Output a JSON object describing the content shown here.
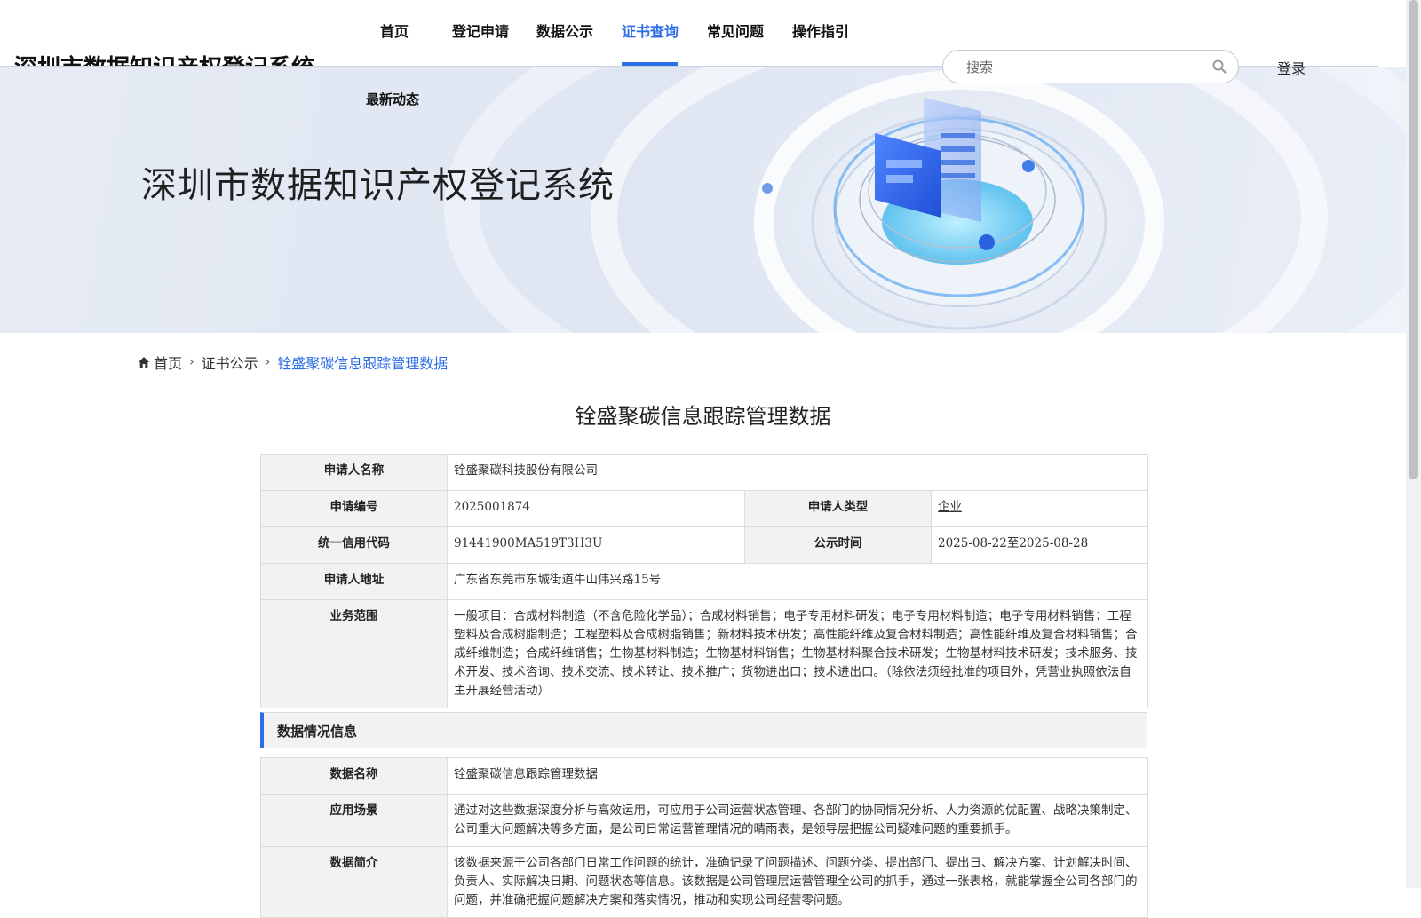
{
  "header": {
    "site_title": "深圳市数据知识产权登记系统",
    "nav": [
      {
        "label": "首页"
      },
      {
        "label": "登记申请"
      },
      {
        "label": "数据公示"
      },
      {
        "label": "证书查询",
        "active": true
      },
      {
        "label": "常见问题"
      },
      {
        "label": "操作指引"
      },
      {
        "label": "最新动态"
      }
    ],
    "search_placeholder": "搜索",
    "login_label": "登录"
  },
  "banner": {
    "title": "深圳市数据知识产权登记系统"
  },
  "breadcrumb": [
    "首页",
    "证书公示",
    "铨盛聚碳信息跟踪管理数据"
  ],
  "page_title": "铨盛聚碳信息跟踪管理数据",
  "applicant": {
    "name_label": "申请人名称",
    "name_value": "铨盛聚碳科技股份有限公司",
    "number_label": "申请编号",
    "number_value": "2025001874",
    "type_label": "申请人类型",
    "type_value": "企业",
    "credit_label": "统一信用代码",
    "credit_value": "91441900MA519T3H3U",
    "publicity_label": "公示时间",
    "publicity_value": "2025-08-22至2025-08-28",
    "address_label": "申请人地址",
    "address_value": "广东省东莞市东城街道牛山伟兴路15号",
    "scope_label": "业务范围",
    "scope_value": "一般项目：合成材料制造（不含危险化学品）；合成材料销售；电子专用材料研发；电子专用材料制造；电子专用材料销售；工程塑料及合成树脂制造；工程塑料及合成树脂销售；新材料技术研发；高性能纤维及复合材料制造；高性能纤维及复合材料销售；合成纤维制造；合成纤维销售；生物基材料制造；生物基材料销售；生物基材料聚合技术研发；生物基材料技术研发；技术服务、技术开发、技术咨询、技术交流、技术转让、技术推广；货物进出口；技术进出口。（除依法须经批准的项目外，凭营业执照依法自主开展经营活动）"
  },
  "data_section": {
    "title": "数据情况信息",
    "data_name_label": "数据名称",
    "data_name_value": "铨盛聚碳信息跟踪管理数据",
    "scenario_label": "应用场景",
    "scenario_value": "通过对这些数据深度分析与高效运用，可应用于公司运营状态管理、各部门的协同情况分析、人力资源的优配置、战略决策制定、公司重大问题解决等多方面，是公司日常运营管理情况的晴雨表，是领导层把握公司疑难问题的重要抓手。",
    "intro_label": "数据简介",
    "intro_value": "该数据来源于公司各部门日常工作问题的统计，准确记录了问题描述、问题分类、提出部门、提出日、解决方案、计划解决时间、负责人、实际解决日期、问题状态等信息。该数据是公司管理层运营管理全公司的抓手，通过一张表格，就能掌握全公司各部门的问题，并准确把握问题解决方案和落实情况，推动和实现公司经营零问题。"
  },
  "colors": {
    "accent": "#2d6de6",
    "label_bg": "#f2f2f2",
    "border": "#dcdcdc"
  },
  "icons": [
    "search-icon",
    "home-icon",
    "chevron-right-icon"
  ]
}
